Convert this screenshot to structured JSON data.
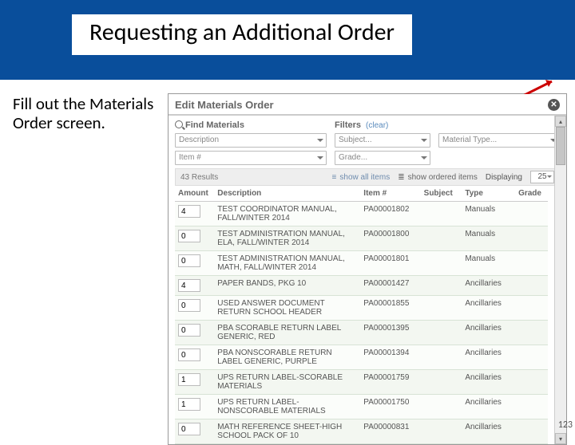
{
  "slide": {
    "title": "Requesting an Additional Order",
    "instruction": "Fill out the Materials Order screen.",
    "page_number": "123"
  },
  "dialog": {
    "title": "Edit Materials Order",
    "close_glyph": "✕",
    "find_label": "Find Materials",
    "filters_label": "Filters",
    "filters_clear": "(clear)",
    "inputs": {
      "description_placeholder": "Description",
      "item_placeholder": "Item #",
      "subject_placeholder": "Subject...",
      "grade_placeholder": "Grade...",
      "material_type_placeholder": "Material Type..."
    },
    "bar": {
      "results": "43 Results",
      "show_all": "show all items",
      "show_ordered": "show ordered items",
      "displaying": "Displaying",
      "page_size": "25"
    },
    "columns": {
      "amount": "Amount",
      "description": "Description",
      "item": "Item #",
      "subject": "Subject",
      "type": "Type",
      "grade": "Grade"
    },
    "rows": [
      {
        "amount": "4",
        "description": "TEST COORDINATOR MANUAL, FALL/WINTER 2014",
        "item": "PA00001802",
        "subject": "",
        "type": "Manuals",
        "grade": ""
      },
      {
        "amount": "0",
        "description": "TEST ADMINISTRATION MANUAL, ELA, FALL/WINTER 2014",
        "item": "PA00001800",
        "subject": "",
        "type": "Manuals",
        "grade": ""
      },
      {
        "amount": "0",
        "description": "TEST ADMINISTRATION MANUAL, MATH, FALL/WINTER 2014",
        "item": "PA00001801",
        "subject": "",
        "type": "Manuals",
        "grade": ""
      },
      {
        "amount": "4",
        "description": "PAPER BANDS, PKG 10",
        "item": "PA00001427",
        "subject": "",
        "type": "Ancillaries",
        "grade": ""
      },
      {
        "amount": "0",
        "description": "USED ANSWER DOCUMENT RETURN SCHOOL HEADER",
        "item": "PA00001855",
        "subject": "",
        "type": "Ancillaries",
        "grade": ""
      },
      {
        "amount": "0",
        "description": "PBA SCORABLE RETURN LABEL GENERIC, RED",
        "item": "PA00001395",
        "subject": "",
        "type": "Ancillaries",
        "grade": ""
      },
      {
        "amount": "0",
        "description": "PBA NONSCORABLE RETURN LABEL GENERIC, PURPLE",
        "item": "PA00001394",
        "subject": "",
        "type": "Ancillaries",
        "grade": ""
      },
      {
        "amount": "1",
        "description": "UPS RETURN LABEL-SCORABLE MATERIALS",
        "item": "PA00001759",
        "subject": "",
        "type": "Ancillaries",
        "grade": ""
      },
      {
        "amount": "1",
        "description": "UPS RETURN LABEL-NONSCORABLE MATERIALS",
        "item": "PA00001750",
        "subject": "",
        "type": "Ancillaries",
        "grade": ""
      },
      {
        "amount": "0",
        "description": "MATH REFERENCE SHEET-HIGH SCHOOL PACK OF 10",
        "item": "PA00000831",
        "subject": "",
        "type": "Ancillaries",
        "grade": ""
      }
    ]
  }
}
